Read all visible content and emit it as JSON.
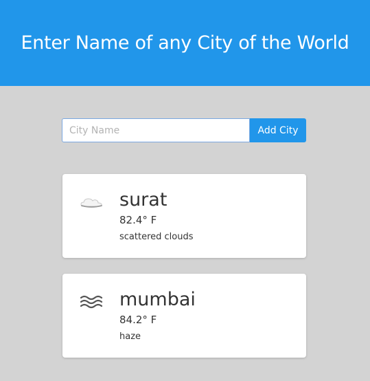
{
  "header": {
    "title": "Enter Name of any City of the World",
    "background": "#2196ea"
  },
  "form": {
    "input_value": "",
    "input_placeholder": "City Name",
    "add_button_label": "Add City"
  },
  "cards": [
    {
      "icon": "scattered-clouds-icon",
      "city": "surat",
      "temperature": "82.4° F",
      "description": "scattered clouds"
    },
    {
      "icon": "haze-icon",
      "city": "mumbai",
      "temperature": "84.2° F",
      "description": "haze"
    }
  ]
}
